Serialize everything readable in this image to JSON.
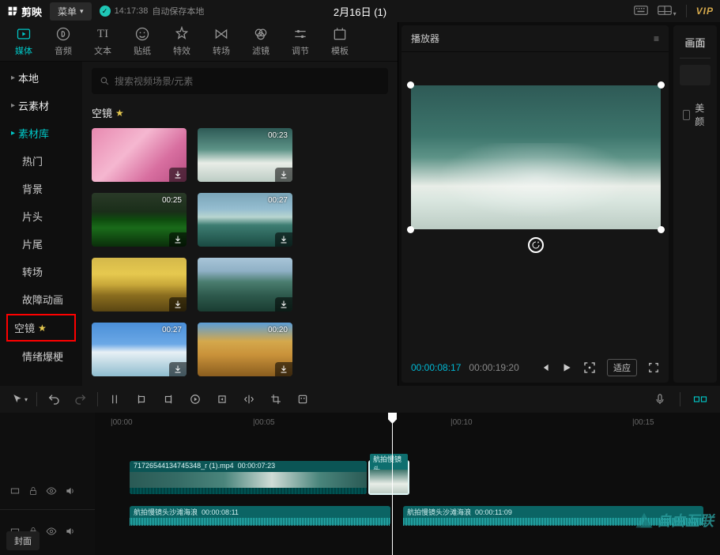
{
  "titlebar": {
    "app_name": "剪映",
    "menu": "菜单",
    "autosave_time": "14:17:38",
    "autosave_text": "自动保存本地",
    "doc_title": "2月16日 (1)",
    "vip": "VIP"
  },
  "tabs": [
    {
      "label": "媒体"
    },
    {
      "label": "音频"
    },
    {
      "label": "文本"
    },
    {
      "label": "贴纸"
    },
    {
      "label": "特效"
    },
    {
      "label": "转场"
    },
    {
      "label": "滤镜"
    },
    {
      "label": "调节"
    },
    {
      "label": "模板"
    }
  ],
  "sidebar": {
    "groups": [
      {
        "label": "本地",
        "expanded": false
      },
      {
        "label": "云素材",
        "expanded": false
      },
      {
        "label": "素材库",
        "expanded": true,
        "active": true
      }
    ],
    "items": [
      "热门",
      "背景",
      "片头",
      "片尾",
      "转场",
      "故障动画",
      "空镜",
      "情绪爆梗"
    ],
    "active_item": "空镜"
  },
  "search": {
    "placeholder": "搜索视频场景/元素"
  },
  "section": {
    "title": "空镜"
  },
  "thumbs": [
    {
      "dur": "",
      "grad": "linear-gradient(135deg,#e889b0 0%,#f5b7d0 40%,#d86fa0 70%,#b84d82 100%)"
    },
    {
      "dur": "00:23",
      "grad": "linear-gradient(180deg,#2e5a56 0%,#5d9387 40%,#e8ede7 65%,#bcccc4 100%)"
    },
    {
      "dur": "00:25",
      "grad": "linear-gradient(180deg,#2a3a28 0%,#1a2e19 35%,#0e4d0e 50%,#1a6b1a 65%,#0a2e0a 100%)"
    },
    {
      "dur": "00:27",
      "grad": "linear-gradient(180deg,#7aa5b8 0%,#95bdd0 30%,#b8d5d0 45%,#3d7d72 60%,#1a4a42 100%)"
    },
    {
      "dur": "",
      "grad": "linear-gradient(180deg,#d4b84a 0%,#e6c94f 30%,#c9a83a 50%,#8a6d1f 70%,#5a4612 100%)"
    },
    {
      "dur": "",
      "grad": "linear-gradient(180deg,#a8c5d8 0%,#8fb0c5 25%,#4a7d6f 45%,#2e5a4d 70%,#1a3d32 100%)"
    },
    {
      "dur": "00:27",
      "grad": "linear-gradient(180deg,#4a8fd8 0%,#6ba8e6 40%,#e8f0f5 55%,#8fbdcf 100%)"
    },
    {
      "dur": "00:20",
      "grad": "linear-gradient(180deg,#5a9dd8 0%,#d4a84c 35%,#c9923a 60%,#8a5d1f 100%)"
    }
  ],
  "player": {
    "title": "播放器",
    "current": "00:00:08:17",
    "total": "00:00:19:20",
    "adapt": "适应"
  },
  "inspector": {
    "tab": "画面",
    "beauty": "美颜"
  },
  "ruler": {
    "marks": [
      {
        "label": "|00:00",
        "pos": 20
      },
      {
        "label": "|00:05",
        "pos": 200
      },
      {
        "label": "|00:10",
        "pos": 450
      },
      {
        "label": "|00:15",
        "pos": 680
      }
    ]
  },
  "clips": {
    "video": {
      "name": "71726544134745348_r (1).mp4",
      "dur": "00:00:07:23"
    },
    "insert": {
      "label": "航拍慢镜头"
    },
    "audio1": {
      "name": "航拍慢镜头沙滩海浪",
      "dur": "00:00:08:11"
    },
    "audio2": {
      "name": "航拍慢镜头沙滩海浪",
      "dur": "00:00:11:09"
    }
  },
  "cover_btn": "封面",
  "watermark": "自由互联"
}
